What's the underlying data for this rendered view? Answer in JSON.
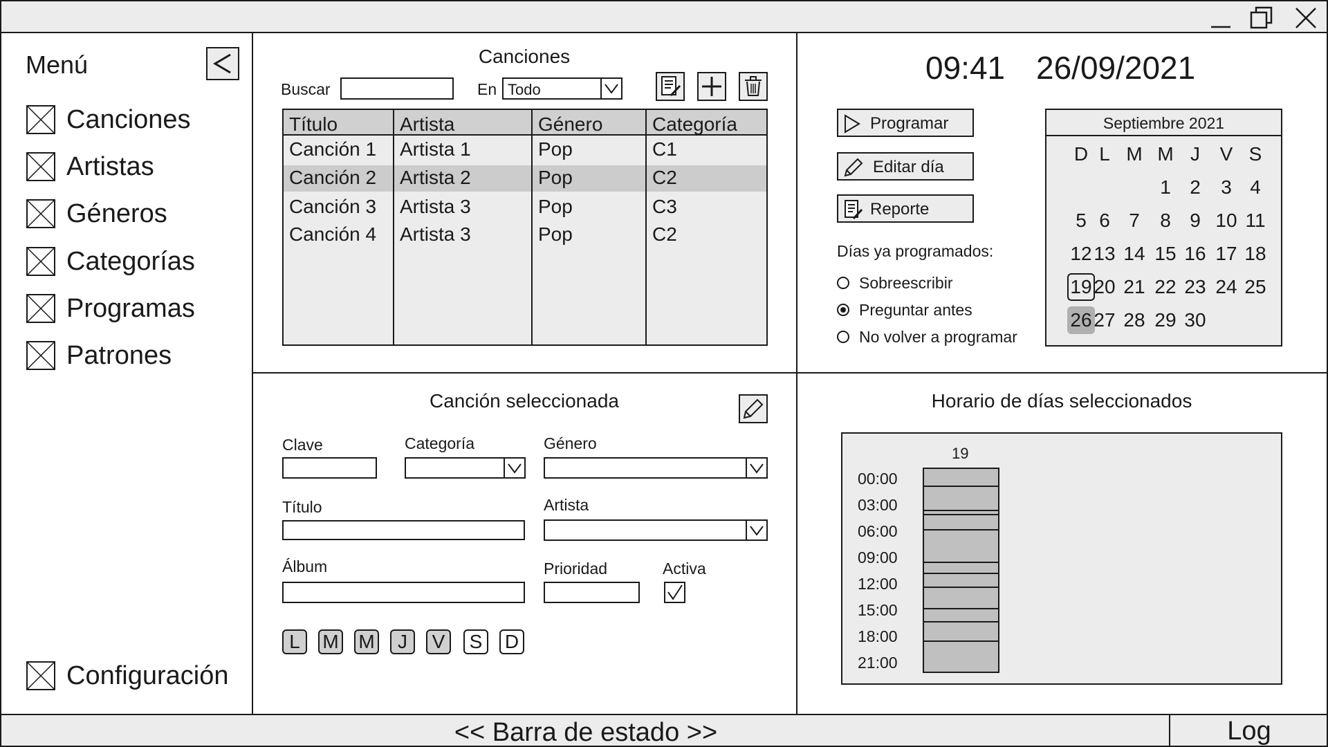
{
  "window": {
    "controls": [
      "minimize-icon",
      "maximize-icon",
      "close-icon"
    ]
  },
  "menu": {
    "title": "Menú",
    "collapse_label": "<",
    "items": [
      {
        "label": "Canciones",
        "icon": "placeholder-x-icon"
      },
      {
        "label": "Artistas",
        "icon": "placeholder-x-icon"
      },
      {
        "label": "Géneros",
        "icon": "placeholder-x-icon"
      },
      {
        "label": "Categorías",
        "icon": "placeholder-x-icon"
      },
      {
        "label": "Programas",
        "icon": "placeholder-x-icon"
      },
      {
        "label": "Patrones",
        "icon": "placeholder-x-icon"
      }
    ],
    "config_label": "Configuración"
  },
  "songs": {
    "title": "Canciones",
    "search_label": "Buscar",
    "search_value": "",
    "in_label": "En",
    "in_value": "Todo",
    "toolbar_icons": [
      "edit-list-icon",
      "add-icon",
      "trash-icon"
    ],
    "columns": [
      "Título",
      "Artista",
      "Género",
      "Categoría"
    ],
    "rows": [
      {
        "title": "Canción 1",
        "artist": "Artista 1",
        "genre": "Pop",
        "category": "C1"
      },
      {
        "title": "Canción 2",
        "artist": "Artista 2",
        "genre": "Pop",
        "category": "C2"
      },
      {
        "title": "Canción 3",
        "artist": "Artista 3",
        "genre": "Pop",
        "category": "C3"
      },
      {
        "title": "Canción 4",
        "artist": "Artista 3",
        "genre": "Pop",
        "category": "C2"
      }
    ],
    "selected_row_index": 1
  },
  "schedule": {
    "time": "09:41",
    "date": "26/09/2021",
    "program_label": "Programar",
    "edit_day_label": "Editar día",
    "report_label": "Reporte",
    "already_label": "Días ya programados:",
    "options": [
      {
        "label": "Sobreescribir",
        "selected": false
      },
      {
        "label": "Preguntar antes",
        "selected": true
      },
      {
        "label": "No volver a programar",
        "selected": false
      }
    ]
  },
  "calendar": {
    "month_label": "Septiembre 2021",
    "weekdays": [
      "D",
      "L",
      "M",
      "M",
      "J",
      "V",
      "S"
    ],
    "first_weekday_index": 3,
    "days_in_month": 30,
    "outlined_day": 19,
    "selected_day": 26
  },
  "selected_song": {
    "title": "Canción seleccionada",
    "edit_icon": "pencil-icon",
    "fields": {
      "clave_label": "Clave",
      "clave_value": "",
      "categoria_label": "Categoría",
      "categoria_value": "",
      "genero_label": "Género",
      "genero_value": "",
      "titulo_label": "Título",
      "titulo_value": "",
      "artista_label": "Artista",
      "artista_value": "",
      "album_label": "Álbum",
      "album_value": "",
      "prioridad_label": "Prioridad",
      "prioridad_value": "",
      "activa_label": "Activa",
      "activa_checked": true
    },
    "days": [
      {
        "label": "L",
        "on": true
      },
      {
        "label": "M",
        "on": true
      },
      {
        "label": "M",
        "on": true
      },
      {
        "label": "J",
        "on": true
      },
      {
        "label": "V",
        "on": true
      },
      {
        "label": "S",
        "on": false
      },
      {
        "label": "D",
        "on": false
      }
    ]
  },
  "day_schedule": {
    "title": "Horario de días seleccionados",
    "day_label": "19",
    "hours": [
      "00:00",
      "03:00",
      "06:00",
      "09:00",
      "12:00",
      "15:00",
      "18:00",
      "21:00"
    ],
    "slot_boundaries_hours": [
      2,
      4.8,
      5.3,
      7.1,
      11,
      12.3,
      13.9,
      16.5,
      18,
      20.3
    ]
  },
  "status": {
    "text": "<< Barra de estado >>",
    "log_label": "Log"
  }
}
